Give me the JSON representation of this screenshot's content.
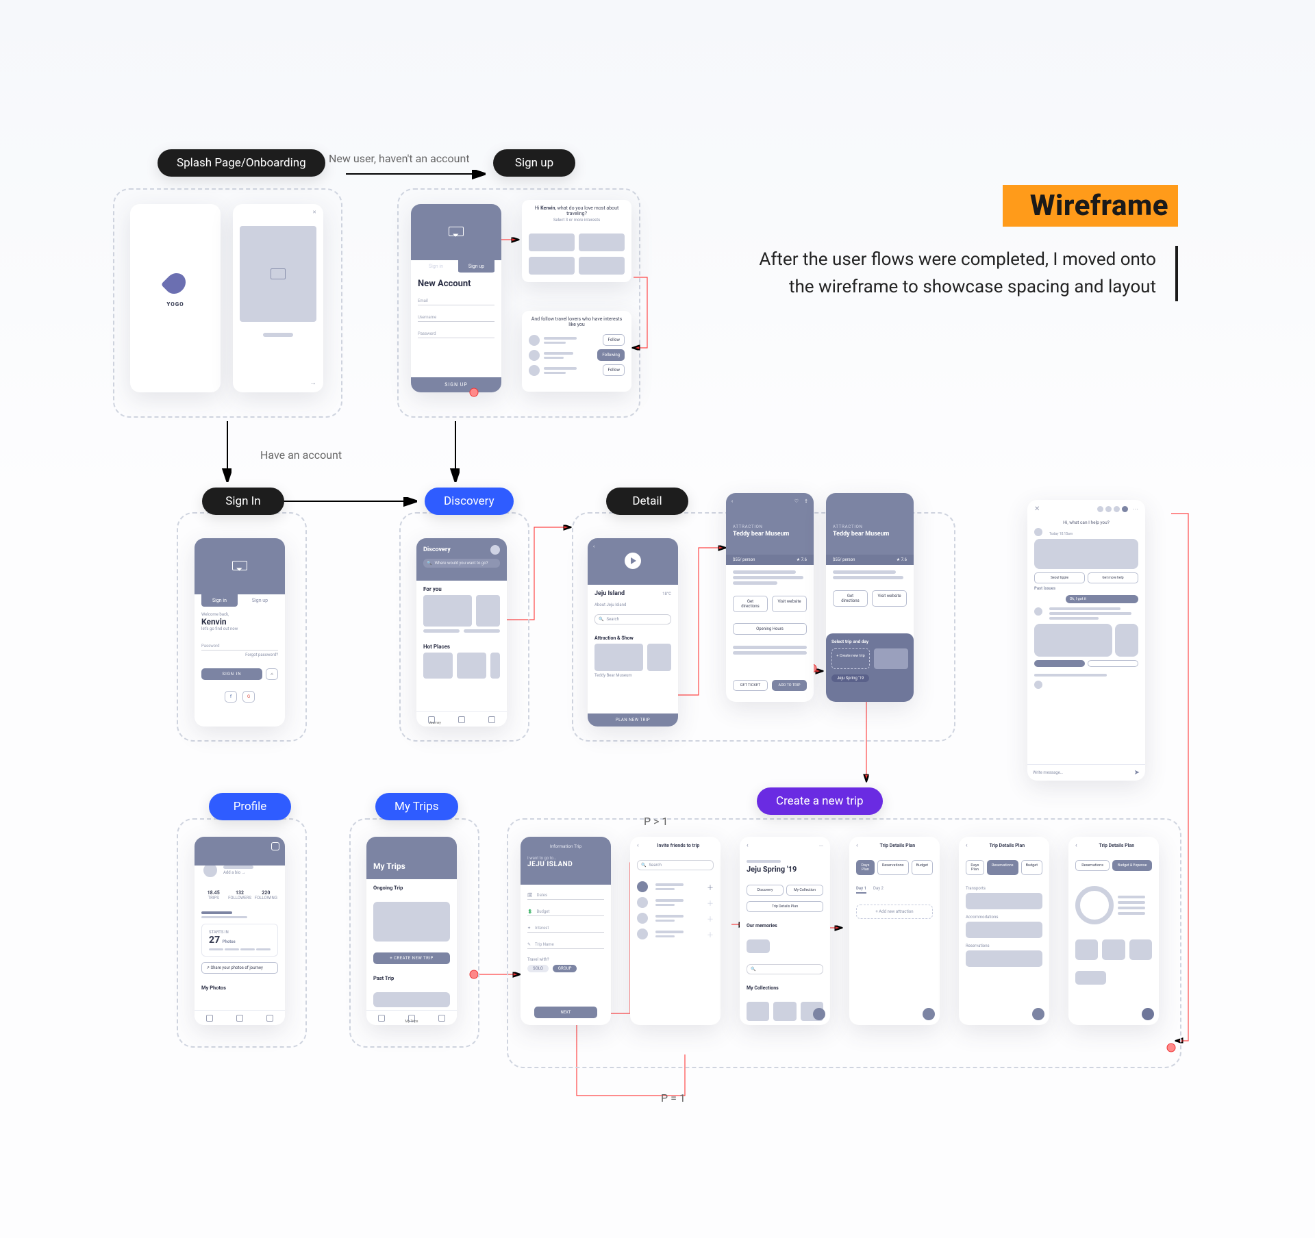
{
  "heading": {
    "title": "Wireframe",
    "subtitle_line1": "After the user flows were completed, I moved onto",
    "subtitle_line2": "the wireframe to showcase spacing and layout"
  },
  "flow": {
    "new_user": "New user, haven't an account",
    "have_account": "Have an account",
    "p_gt_1": "P > 1",
    "p_eq_1": "P = 1"
  },
  "tags": {
    "splash": "Splash Page/Onboarding",
    "signup": "Sign up",
    "signin": "Sign In",
    "discovery": "Discovery",
    "detail": "Detail",
    "profile": "Profile",
    "mytrips": "My Trips",
    "newtrip": "Create a new trip"
  },
  "splash": {
    "logo": "YOGO",
    "logo_sub": "—"
  },
  "signup": {
    "tab_signin": "Sign in",
    "tab_signup": "Sign up",
    "title": "New Account",
    "email": "Email",
    "username": "Username",
    "password": "Password",
    "btn": "SIGN UP"
  },
  "onboard_cards": {
    "q1_pre": "Hi ",
    "q1_name": "Kenvin",
    "q1_post": ", what do you love most about traveling?",
    "q1_sub": "Select 3 or more interests",
    "q2": "And follow travel lovers who have interests like you",
    "follow": "Follow",
    "following": "Following"
  },
  "signin": {
    "tab_signin": "Sign in",
    "tab_signup": "Sign up",
    "welcome": "Welcome back,",
    "name": "Kenvin",
    "sub": "let's go find out now",
    "password": "Password",
    "forgot": "Forgot password?",
    "btn": "SIGN IN"
  },
  "discovery": {
    "title": "Discovery",
    "search_ph": "Where would you want to go?",
    "for_you": "For you",
    "hot": "Hot Places",
    "nav_label": "Journey"
  },
  "detail_overview": {
    "title": "Jeju Island",
    "temp": "18°C",
    "sub": "About Jeju Island",
    "search": "Search",
    "section": "Attraction & Show",
    "attraction": "Teddy Bear Museum",
    "cta": "PLAN NEW TRIP"
  },
  "detail_item": {
    "cat": "ATTRACTION",
    "title": "Teddy bear Museum",
    "price": "$55/ person",
    "rating": "7.6",
    "get_dir": "Get directions",
    "visit": "Visit website",
    "hours": "Opening Hours",
    "get_ticket": "GET TICKET",
    "add_trip": "ADD TO TRIP",
    "pick_title": "Select trip and day",
    "pick_new": "+ Create new trip",
    "pick_chip": "Jeju Spring '19"
  },
  "chat": {
    "title": "Hi, what can I help you?",
    "opt1": "Seoul tipple",
    "opt2": "Get more help",
    "past": "Past issues",
    "okgot": "Ok, I got it",
    "input_ph": "Write message…"
  },
  "profile": {
    "add_bio": "Add a bio →",
    "trips": "TRIPS",
    "trips_n": "18.45",
    "followers": "FOLLOWERS",
    "followers_n": "132",
    "following": "FOLLOWING",
    "following_n": "220",
    "big_count": "27",
    "big_label": "Photos",
    "starts": "STARTS IN",
    "share": "↗  Share your photos of journey",
    "my_photos": "My Photos"
  },
  "mytrips": {
    "title": "My Trips",
    "ongoing": "Ongoing Trip",
    "create": "+  CREATE NEW TRIP",
    "past": "Past Trip",
    "nav_label": "My Trips"
  },
  "info_trip": {
    "header": "Information Trip",
    "lead": "I want to go to…",
    "dest": "JEJU ISLAND",
    "dates": "Dates",
    "budget": "Budget",
    "interest": "Interest",
    "tripname": "Trip Name",
    "travel_with": "Travel with?",
    "solo": "SOLO",
    "grp": "GROUP",
    "next": "NEXT"
  },
  "invite": {
    "title": "Invite friends to trip",
    "search_ph": "Search"
  },
  "trip_detail": {
    "title": "Jeju Spring '19",
    "tab_disc": "Discovery",
    "tab_coll": "My Collection",
    "tab_plan": "Trip Details Plan",
    "memories": "Our memories",
    "collections": "My Collections"
  },
  "plan": {
    "header": "Trip Details Plan",
    "tab_days": "Days Plan",
    "tab_res": "Reservations",
    "tab_budget": "Budget",
    "day1": "Day 1",
    "day2": "Day 2",
    "add_attr": "+  Add new attraction",
    "tab_bx": "Budget & Expense",
    "cat1": "Transports",
    "cat2": "Accommodations",
    "cat3": "Reservations"
  }
}
